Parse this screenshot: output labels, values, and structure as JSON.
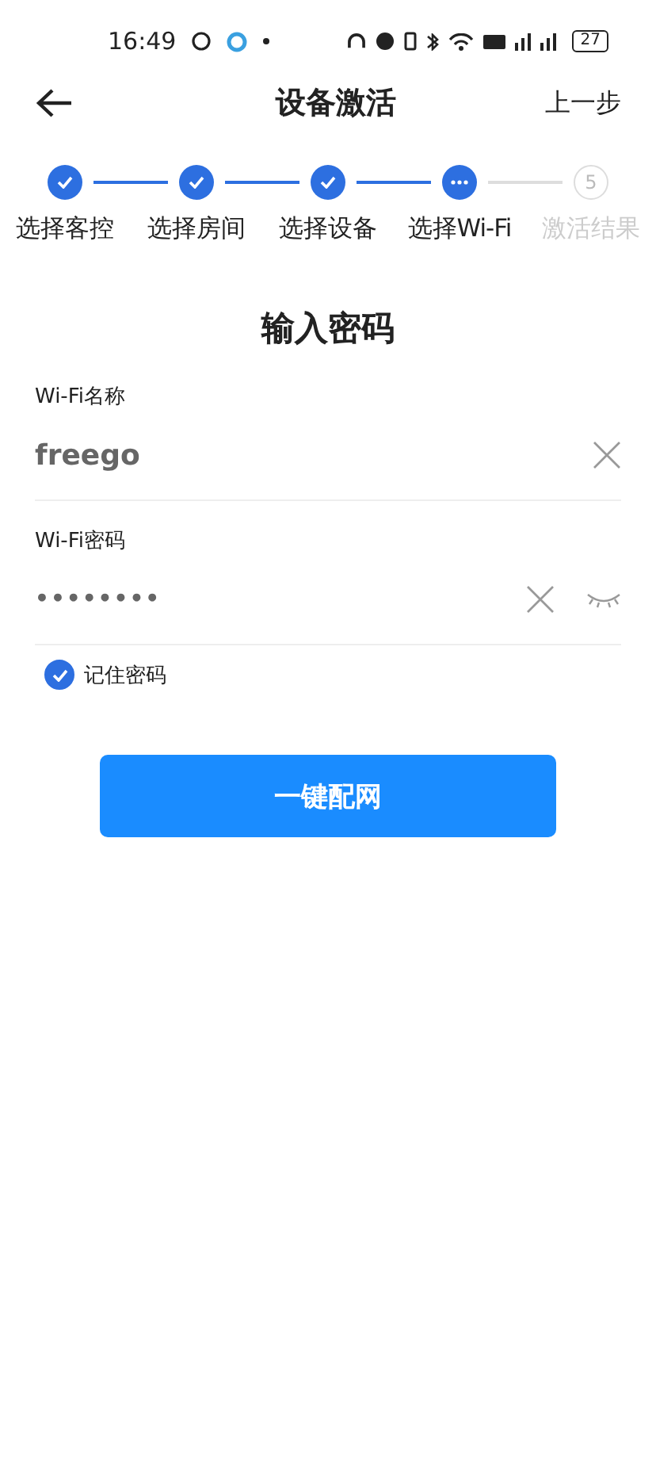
{
  "status_bar": {
    "time": "16:49",
    "battery": "27"
  },
  "header": {
    "title": "设备激活",
    "action": "上一步"
  },
  "steps": [
    {
      "label": "选择客控",
      "kind": "done"
    },
    {
      "label": "选择房间",
      "kind": "done"
    },
    {
      "label": "选择设备",
      "kind": "done"
    },
    {
      "label": "选择Wi-Fi",
      "kind": "current"
    },
    {
      "label": "激活结果",
      "kind": "pending",
      "number": "5"
    }
  ],
  "form": {
    "title": "输入密码",
    "fields": [
      {
        "label": "Wi-Fi名称",
        "value": "freego",
        "kind": "name"
      },
      {
        "label": "Wi-Fi密码",
        "value": "••••••••",
        "kind": "password"
      }
    ],
    "remember": {
      "label": "记住密码",
      "checked": true
    },
    "submit": "一键配网"
  }
}
